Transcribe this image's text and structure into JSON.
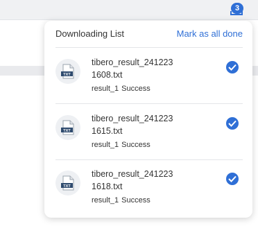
{
  "header": {
    "download_count": "3"
  },
  "panel": {
    "title": "Downloading List",
    "mark_all_label": "Mark as all done",
    "items": [
      {
        "file_name": "tibero_result_2412231608.txt",
        "result": "result_1",
        "status": "Success",
        "icon_text": "TXT"
      },
      {
        "file_name": "tibero_result_2412231615.txt",
        "result": "result_1",
        "status": "Success",
        "icon_text": "TXT"
      },
      {
        "file_name": "tibero_result_2412231618.txt",
        "result": "result_1",
        "status": "Success",
        "icon_text": "TXT"
      }
    ]
  },
  "colors": {
    "accent": "#2f6fd6",
    "text": "#333333",
    "divider": "#e3e5e8"
  }
}
